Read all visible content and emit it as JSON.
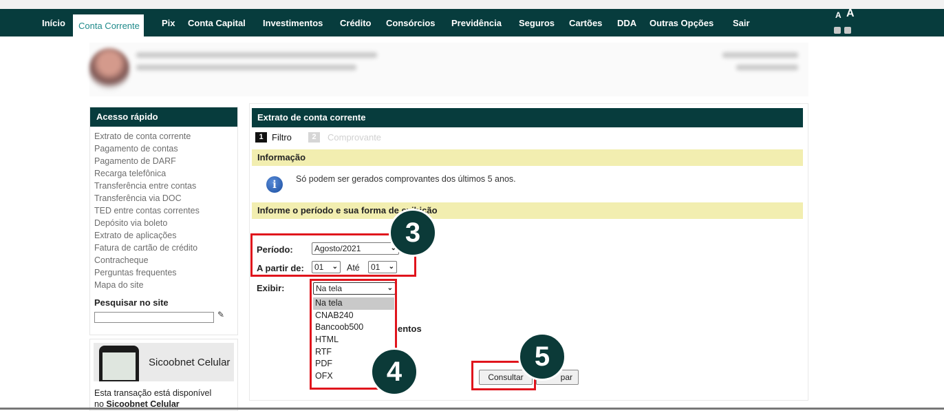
{
  "nav": {
    "items": [
      "Início",
      "Conta Corrente",
      "Pix",
      "Conta Capital",
      "Investimentos",
      "Crédito",
      "Consórcios",
      "Previdência",
      "Seguros",
      "Cartões",
      "DDA",
      "Outras Opções",
      "Sair"
    ],
    "active": "Conta Corrente",
    "font_small": "A",
    "font_large": "A"
  },
  "sidebar": {
    "title": "Acesso rápido",
    "links": [
      "Extrato de conta corrente",
      "Pagamento de contas",
      "Pagamento de DARF",
      "Recarga telefônica",
      "Transferência entre contas",
      "Transferência via DOC",
      "TED entre contas correntes",
      "Depósito via boleto",
      "Extrato de aplicações",
      "Fatura de cartão de crédito",
      "Contracheque",
      "Perguntas frequentes",
      "Mapa do site"
    ],
    "search_label": "Pesquisar no site",
    "search_value": ""
  },
  "promo": {
    "title": "Sicoobnet Celular",
    "text_1": "Esta transação está disponível",
    "text_2_prefix": "no ",
    "text_2_bold": "Sicoobnet Celular"
  },
  "main": {
    "title": "Extrato de conta corrente",
    "step1_num": "1",
    "step1_label": "Filtro",
    "step2_num": "2",
    "step2_label": "Comprovante",
    "info_title": "Informação",
    "info_text": "Só podem ser gerados comprovantes dos últimos 5 anos.",
    "section_title": "Informe o período e sua forma de exibição",
    "periodo_label": "Período:",
    "periodo_value": "Agosto/2021",
    "apartir_label": "A partir de:",
    "apartir_value": "01",
    "ate_label": "Até",
    "ate_value": "01",
    "exibir_label": "Exibir:",
    "exibir_value": "Na tela",
    "exibir_options": [
      "Na tela",
      "CNAB240",
      "Bancoob500",
      "HTML",
      "RTF",
      "PDF",
      "OFX"
    ],
    "exibir_selected": "Na tela",
    "hidden_text_fragment": "entos",
    "consultar_label": "Consultar",
    "limpar_label": "Limpar",
    "limpar_visible": "par"
  },
  "annotations": {
    "badge_3": "3",
    "badge_4": "4",
    "badge_5": "5"
  },
  "colors": {
    "nav_bg": "#073c3d",
    "active_tab_text": "#1f8a8a",
    "section_bar": "#f2eeb0",
    "highlight_red": "#e0141c",
    "badge_bg": "#0b3a38"
  }
}
